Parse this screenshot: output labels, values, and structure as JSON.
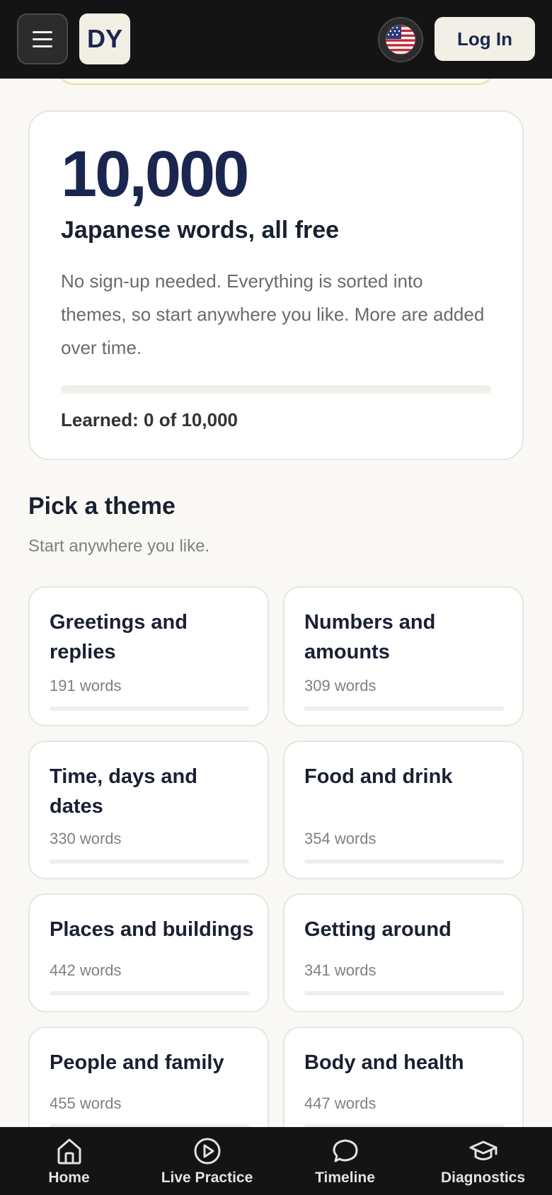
{
  "header": {
    "logo_text": "DY",
    "login_label": "Log In",
    "language_flag": "us-flag-icon"
  },
  "hero": {
    "number": "10,000",
    "title": "Japanese words, all free",
    "description": "No sign-up needed. Everything is sorted into themes, so start anywhere you like. More are added over time.",
    "learned_text": "Learned: 0 of 10,000",
    "progress_fraction": 0
  },
  "themes_section": {
    "title": "Pick a theme",
    "subtitle": "Start anywhere you like."
  },
  "themes": [
    {
      "name": "Greetings and replies",
      "count": "191 words",
      "progress_fraction": 0
    },
    {
      "name": "Numbers and amounts",
      "count": "309 words",
      "progress_fraction": 0
    },
    {
      "name": "Time, days and dates",
      "count": "330 words",
      "progress_fraction": 0
    },
    {
      "name": "Food and drink",
      "count": "354 words",
      "progress_fraction": 0
    },
    {
      "name": "Places and buildings",
      "count": "442 words",
      "progress_fraction": 0
    },
    {
      "name": "Getting around",
      "count": "341 words",
      "progress_fraction": 0
    },
    {
      "name": "People and family",
      "count": "455 words",
      "progress_fraction": 0
    },
    {
      "name": "Body and health",
      "count": "447 words",
      "progress_fraction": 0
    }
  ],
  "bottom_nav": [
    {
      "label": "Home",
      "icon": "home-icon"
    },
    {
      "label": "Live Practice",
      "icon": "play-circle-icon"
    },
    {
      "label": "Timeline",
      "icon": "chat-bubble-icon"
    },
    {
      "label": "Diagnostics",
      "icon": "graduation-cap-icon"
    }
  ],
  "colors": {
    "background": "#f9f8f4",
    "header_bg": "#141414",
    "brand_navy": "#1b2650",
    "card_border": "#e8e6df"
  }
}
